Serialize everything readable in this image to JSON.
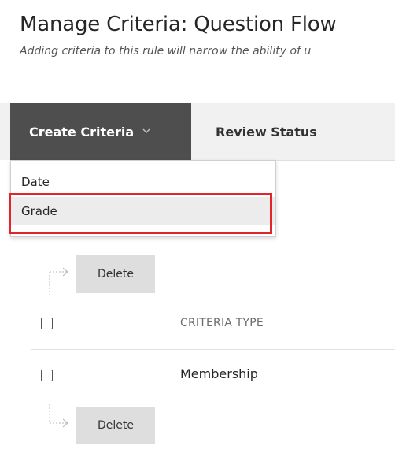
{
  "page": {
    "title": "Manage Criteria: Question Flow",
    "subtitle": "Adding criteria to this rule will narrow the ability of u"
  },
  "toolbar": {
    "create_label": "Create Criteria",
    "create_icon": "chevron-down-icon",
    "review_label": "Review Status"
  },
  "dropdown": {
    "items": [
      {
        "label": "Date"
      },
      {
        "label": "Grade"
      }
    ],
    "highlight_color": "#e3242b"
  },
  "table": {
    "delete_top_label": "Delete",
    "delete_bottom_label": "Delete",
    "column_header": "CRITERIA TYPE",
    "rows": [
      {
        "label": "Membership"
      }
    ]
  },
  "colors": {
    "create_bg": "#4e4e4e",
    "toolbar_bg": "#f1f1f1",
    "delete_bg": "#dedede"
  }
}
